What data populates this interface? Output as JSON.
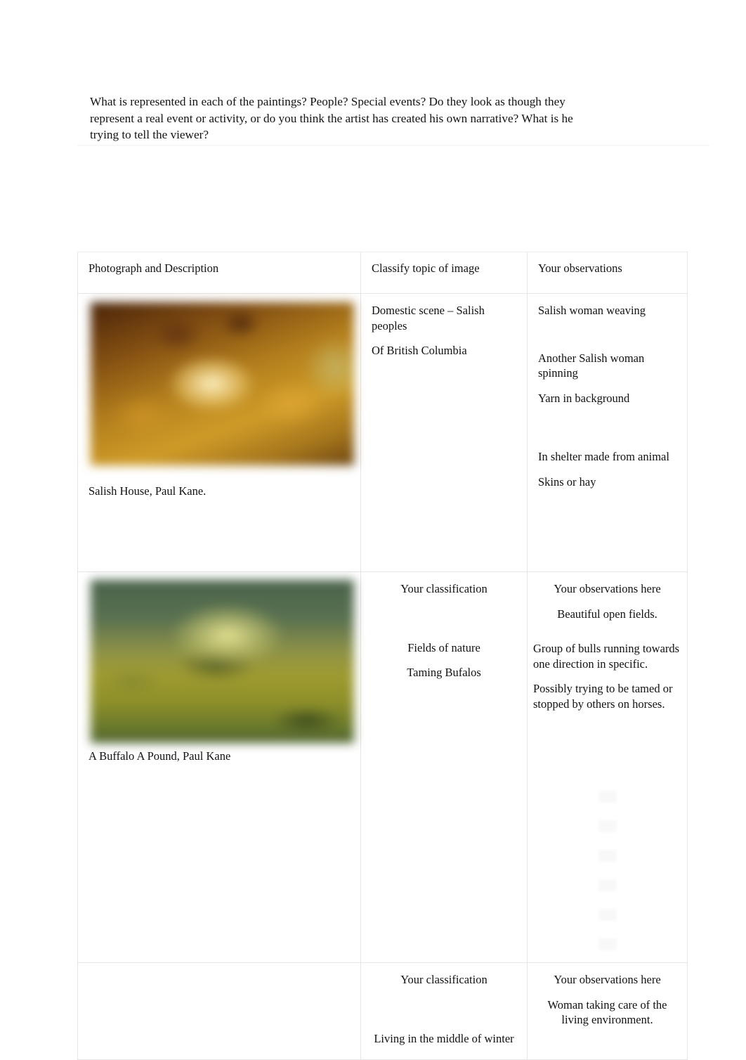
{
  "document": {
    "intro_paragraph": "What is represented in each of the paintings? People? Special events? Do they look as though they represent a real event or activity, or do you think the artist has created his own narrative? What is he trying to tell the viewer?"
  },
  "table": {
    "headers": {
      "col1": "Photograph and Description",
      "col2": "Classify topic of image",
      "col3": "Your observations"
    },
    "rows": [
      {
        "image": {
          "name": "salish-house-painting",
          "alt": "Salish House painting by Paul Kane",
          "dominant_colors": [
            "#4a2409",
            "#b4801d",
            "#cf9c28"
          ]
        },
        "caption": "Salish House, Paul Kane.",
        "classification": [
          "Domestic scene – Salish peoples",
          "Of British Columbia"
        ],
        "observations": [
          "Salish woman weaving",
          "Another Salish woman spinning",
          "Yarn in background",
          "In shelter made from animal",
          "Skins or hay"
        ]
      },
      {
        "image": {
          "name": "a-buffalo-a-pound-painting",
          "alt": "A Buffalo A Pound painting by Paul Kane",
          "dominant_colors": [
            "#49624a",
            "#9f9b31",
            "#6b7a2c"
          ]
        },
        "caption": "A Buffalo A Pound, Paul Kane",
        "classification_prompt": "Your classification",
        "classification": [
          "Fields of nature",
          "Taming Bufalos"
        ],
        "observations_prompt": "Your observations here",
        "observations": [
          "Beautiful open fields.",
          "Group of bulls running towards one direction in specific.",
          "Possibly trying to be tamed or stopped by others on horses."
        ]
      },
      {
        "image": {
          "name": "third-painting-placeholder",
          "alt": ""
        },
        "caption": "",
        "classification_prompt": "Your classification",
        "classification": [
          "Living in the middle of winter"
        ],
        "observations_prompt": "Your observations here",
        "observations": [
          "Woman taking care of the living environment."
        ]
      }
    ]
  }
}
